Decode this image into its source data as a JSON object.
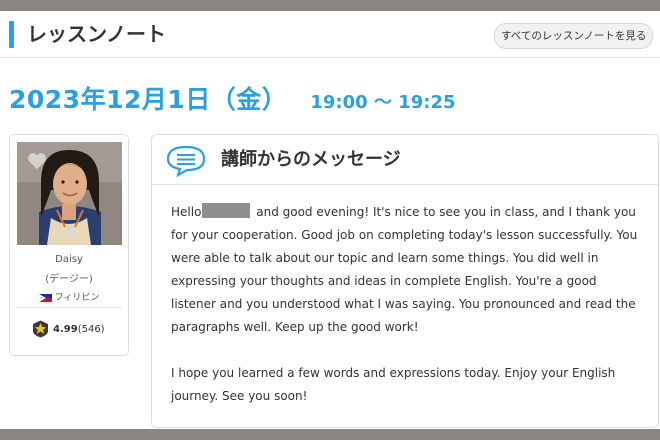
{
  "header": {
    "title": "レッスンノート",
    "all_notes_label": "すべてのレッスンノートを見る"
  },
  "lesson": {
    "date": "2023年12月1日（金）",
    "time": "19:00 〜 19:25"
  },
  "tutor": {
    "name": "Daisy",
    "name_kana": "(デージー)",
    "country": "フィリピン",
    "rating": "4.99",
    "review_count": "(546)"
  },
  "message": {
    "title": "講師からのメッセージ",
    "greeting_start": "Hello",
    "paragraph1_rest": " and good evening! It's nice to see you in class, and I thank you for your cooperation. Good job on completing today's lesson successfully. You were able to talk about our topic and learn some things. You did well in expressing your thoughts and ideas in complete English. You're a good listener and you understood what I was saying. You pronounced and read the paragraphs well. Keep up the good work!",
    "paragraph2": "I hope you learned a few words and expressions today. Enjoy your English journey. See you soon!"
  },
  "colors": {
    "accent": "#2aa0e3",
    "frame": "#8a8582",
    "star": "#e8c21a"
  },
  "icons": {
    "favorite": "heart-icon",
    "message": "speech-bubble-icon",
    "rating": "star-badge-icon",
    "country": "philippines-flag-icon"
  }
}
